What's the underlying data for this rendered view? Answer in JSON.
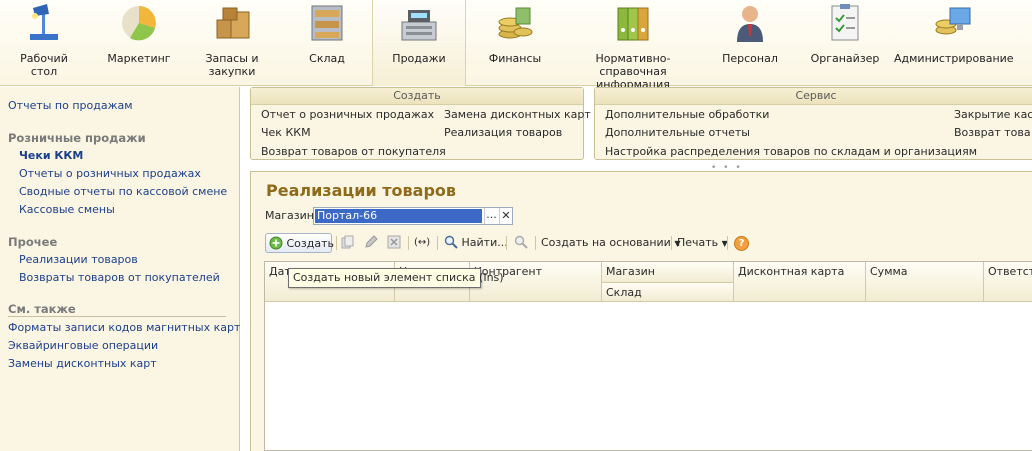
{
  "topnav": [
    {
      "label": "Рабочий\nстол",
      "icon": "desk-lamp-icon"
    },
    {
      "label": "Маркетинг",
      "icon": "pie-chart-icon"
    },
    {
      "label": "Запасы и\nзакупки",
      "icon": "boxes-icon"
    },
    {
      "label": "Склад",
      "icon": "warehouse-shelf-icon"
    },
    {
      "label": "Продажи",
      "icon": "cash-register-icon"
    },
    {
      "label": "Финансы",
      "icon": "coins-icon"
    },
    {
      "label": "Нормативно-справочная\nинформация",
      "icon": "binders-icon"
    },
    {
      "label": "Персонал",
      "icon": "person-icon"
    },
    {
      "label": "Органайзер",
      "icon": "checklist-icon"
    },
    {
      "label": "Администрирование",
      "icon": "admin-computer-icon"
    }
  ],
  "sidebar": {
    "reports_link": "Отчеты по продажам",
    "retail_header": "Розничные продажи",
    "retail_items": [
      "Чеки ККМ",
      "Отчеты о розничных продажах",
      "Сводные отчеты по кассовой смене",
      "Кассовые смены"
    ],
    "other_header": "Прочее",
    "other_items": [
      "Реализации товаров",
      "Возвраты товаров от покупателей"
    ],
    "seealso_header": "См. также",
    "seealso_items": [
      "Форматы записи кодов магнитных карт",
      "Эквайринговые операции",
      "Замены дисконтных карт"
    ]
  },
  "create_panel": {
    "title": "Создать",
    "col1": [
      "Отчет о розничных продажах",
      "Чек ККМ",
      "Возврат товаров от покупателя"
    ],
    "col2": [
      "Замена дисконтных карт",
      "Реализация товаров"
    ]
  },
  "service_panel": {
    "title": "Сервис",
    "col1": [
      "Дополнительные обработки",
      "Дополнительные отчеты",
      "Настройка распределения товаров по складам и организациям"
    ],
    "col2": [
      "Закрытие касс",
      "Возврат това"
    ]
  },
  "form": {
    "title": "Реализации товаров",
    "shop_label": "Магазин:",
    "shop_value": "Портал-66",
    "shop_select": "...",
    "shop_clear": "✕"
  },
  "toolbar": {
    "create": "Создать",
    "find": "Найти...",
    "create_based": "Создать на основании",
    "print": "Печать",
    "help": "?"
  },
  "table": {
    "headers": [
      "Дат",
      "Н",
      "Контрагент",
      "Магазин",
      "Склад",
      "Дисконтная карта",
      "Сумма",
      "Ответст"
    ]
  },
  "tooltip": "Создать новый элемент списка (Ins)",
  "colors": {
    "title": "#8e6a1a",
    "link": "#1c3f8c",
    "panel_bg": "#fbf6e3",
    "selection": "#3d69c6"
  }
}
